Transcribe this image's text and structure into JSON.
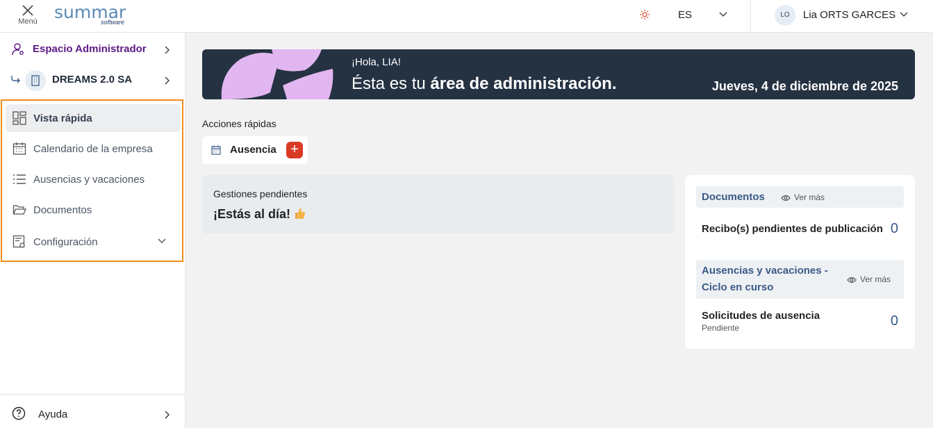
{
  "topbar": {
    "menu_label": "Menú",
    "logo_main": "summar",
    "logo_sub": "software",
    "language": "ES",
    "user_initials": "LO",
    "user_name": "Lia ORTS GARCES"
  },
  "sidebar": {
    "admin_label": "Espacio Administrador",
    "company_label": "DREAMS 2.0 SA",
    "items": [
      {
        "label": "Vista rápida",
        "icon": "dashboard-icon"
      },
      {
        "label": "Calendario de la empresa",
        "icon": "calendar-icon"
      },
      {
        "label": "Ausencias y vacaciones",
        "icon": "list-icon"
      },
      {
        "label": "Documentos",
        "icon": "folder-icon"
      },
      {
        "label": "Configuración",
        "icon": "settings-doc-icon"
      }
    ],
    "help_label": "Ayuda"
  },
  "banner": {
    "greeting": "¡Hola, LIA!",
    "headline_prefix": "Ésta es tu ",
    "headline_bold": "área de administración.",
    "date": "Jueves, 4 de diciembre de 2025"
  },
  "quick_actions": {
    "title": "Acciones rápidas",
    "action_label": "Ausencia",
    "add_symbol": "+"
  },
  "pending": {
    "title": "Gestiones pendientes",
    "message": "¡Estás al día!"
  },
  "widgets": {
    "documents": {
      "title": "Documentos",
      "more": "Ver más",
      "row_label": "Recibo(s) pendientes de publicación",
      "row_value": "0"
    },
    "absences": {
      "title_line1": "Ausencias y vacaciones -",
      "title_line2": "Ciclo en curso",
      "more": "Ver más",
      "row_label": "Solicitudes de ausencia",
      "row_sub": "Pendiente",
      "row_value": "0"
    }
  },
  "colors": {
    "brand_purple": "#5c1a84",
    "banner_bg": "#253242",
    "flower": "#e2b6f0",
    "highlight_border": "#f28a1c",
    "add_button": "#d93a26",
    "link_blue": "#3a5a86"
  }
}
